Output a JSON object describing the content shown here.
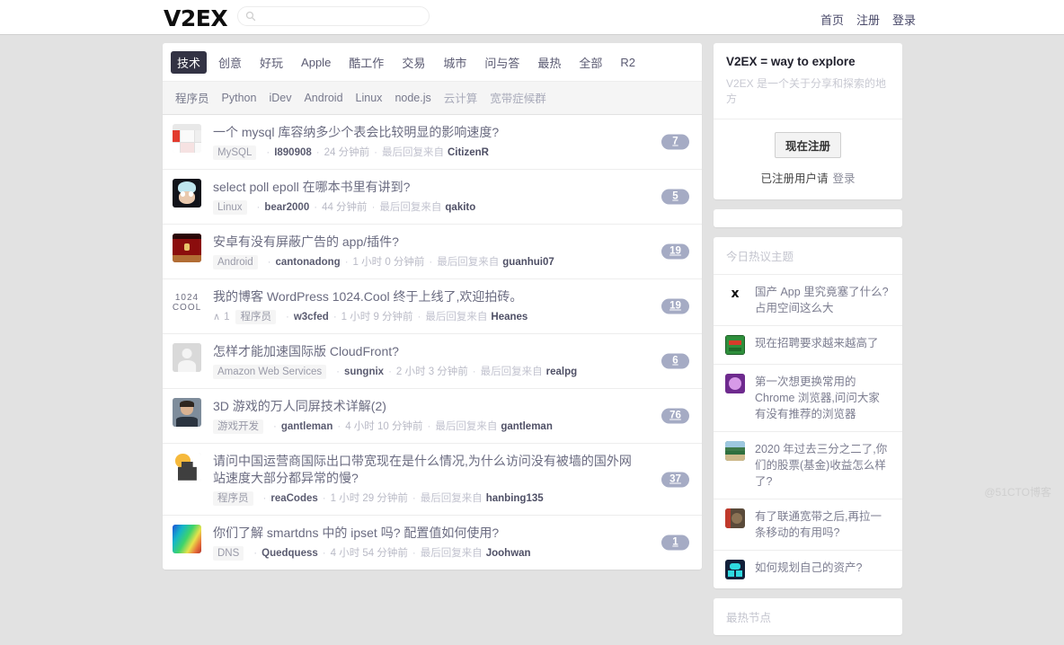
{
  "header": {
    "brand": "V2EX",
    "search": {
      "value": "",
      "placeholder": "",
      "icon": "search-icon"
    },
    "nav": [
      {
        "label": "首页"
      },
      {
        "label": "注册"
      },
      {
        "label": "登录"
      }
    ]
  },
  "tabs": [
    {
      "label": "技术",
      "active": true
    },
    {
      "label": "创意",
      "active": false
    },
    {
      "label": "好玩",
      "active": false
    },
    {
      "label": "Apple",
      "active": false
    },
    {
      "label": "酷工作",
      "active": false
    },
    {
      "label": "交易",
      "active": false
    },
    {
      "label": "城市",
      "active": false
    },
    {
      "label": "问与答",
      "active": false
    },
    {
      "label": "最热",
      "active": false
    },
    {
      "label": "全部",
      "active": false
    },
    {
      "label": "R2",
      "active": false
    }
  ],
  "subtabs": [
    {
      "label": "程序员",
      "muted": false
    },
    {
      "label": "Python",
      "muted": false
    },
    {
      "label": "iDev",
      "muted": false
    },
    {
      "label": "Android",
      "muted": false
    },
    {
      "label": "Linux",
      "muted": false
    },
    {
      "label": "node.js",
      "muted": false
    },
    {
      "label": "云计算",
      "muted": true
    },
    {
      "label": "宽带症候群",
      "muted": true
    }
  ],
  "topics": [
    {
      "title": "一个 mysql 库容纳多少个表会比较明显的影响速度?",
      "node": "MySQL",
      "author": "I890908",
      "time": "24 分钟前",
      "last_reply_label": "最后回复来自",
      "replier": "CitizenR",
      "count": "7",
      "votes": "",
      "avatar_kind": "screenshot-thumb"
    },
    {
      "title": "select poll epoll 在哪本书里有讲到?",
      "node": "Linux",
      "author": "bear2000",
      "time": "44 分钟前",
      "last_reply_label": "最后回复来自",
      "replier": "qakito",
      "count": "5",
      "votes": "",
      "avatar_kind": "rick"
    },
    {
      "title": "安卓有没有屏蔽广告的 app/插件?",
      "node": "Android",
      "author": "cantonadong",
      "time": "1 小时 0 分钟前",
      "last_reply_label": "最后回复来自",
      "replier": "guanhui07",
      "count": "19",
      "votes": "",
      "avatar_kind": "red-poster"
    },
    {
      "title": "我的博客 WordPress 1024.Cool 终于上线了,欢迎拍砖。",
      "node": "程序员",
      "author": "w3cfed",
      "time": "1 小时 9 分钟前",
      "last_reply_label": "最后回复来自",
      "replier": "Heanes",
      "count": "19",
      "votes": "1",
      "avatar_kind": "text-1024"
    },
    {
      "title": "怎样才能加速国际版 CloudFront?",
      "node": "Amazon Web Services",
      "author": "sungnix",
      "time": "2 小时 3 分钟前",
      "last_reply_label": "最后回复来自",
      "replier": "realpg",
      "count": "6",
      "votes": "",
      "avatar_kind": "default-person"
    },
    {
      "title": "3D 游戏的万人同屏技术详解(2)",
      "node": "游戏开发",
      "author": "gantleman",
      "time": "4 小时 10 分钟前",
      "last_reply_label": "最后回复来自",
      "replier": "gantleman",
      "count": "76",
      "votes": "",
      "avatar_kind": "photo-man"
    },
    {
      "title": "请问中国运营商国际出口带宽现在是什么情况,为什么访问没有被墙的国外网站速度大部分都异常的慢?",
      "node": "程序员",
      "author": "reaCodes",
      "time": "1 小时 29 分钟前",
      "last_reply_label": "最后回复来自",
      "replier": "hanbing135",
      "count": "37",
      "votes": "",
      "avatar_kind": "puzzle"
    },
    {
      "title": "你们了解 smartdns 中的 ipset 吗? 配置值如何使用?",
      "node": "DNS",
      "author": "Quedquess",
      "time": "4 小时 54 分钟前",
      "last_reply_label": "最后回复来自",
      "replier": "Joohwan",
      "count": "1",
      "votes": "",
      "avatar_kind": "rainbow"
    }
  ],
  "sidebar": {
    "promo": {
      "title": "V2EX = way to explore",
      "subtitle": "V2EX 是一个关于分享和探索的地方",
      "register_button": "现在注册",
      "login_prefix": "已注册用户请",
      "login_link": "登录"
    },
    "hot_panel": {
      "header": "今日热议主题",
      "items": [
        {
          "text": "国产 App 里究竟塞了什么? 占用空间这么大",
          "avatar_kind": "glyph-black"
        },
        {
          "text": "现在招聘要求越来越高了",
          "avatar_kind": "pixel-green"
        },
        {
          "text": "第一次想更换常用的 Chrome 浏览器,问问大家有没有推荐的浏览器",
          "avatar_kind": "purple-blob"
        },
        {
          "text": "2020 年过去三分之二了,你们的股票(基金)收益怎么样了?",
          "avatar_kind": "landscape"
        },
        {
          "text": "有了联通宽带之后,再拉一条移动的有用吗?",
          "avatar_kind": "dog-photo"
        },
        {
          "text": "如何规划自己的资产?",
          "avatar_kind": "cyan-robot"
        }
      ]
    },
    "nodes_panel": {
      "header": "最热节点"
    }
  },
  "watermark": "@51CTO博客",
  "colors": {
    "page_bg": "#e2e2e2",
    "accent_badge": "#a5abc4",
    "active_tab": "#333344",
    "title_text": "#6a6b80"
  }
}
